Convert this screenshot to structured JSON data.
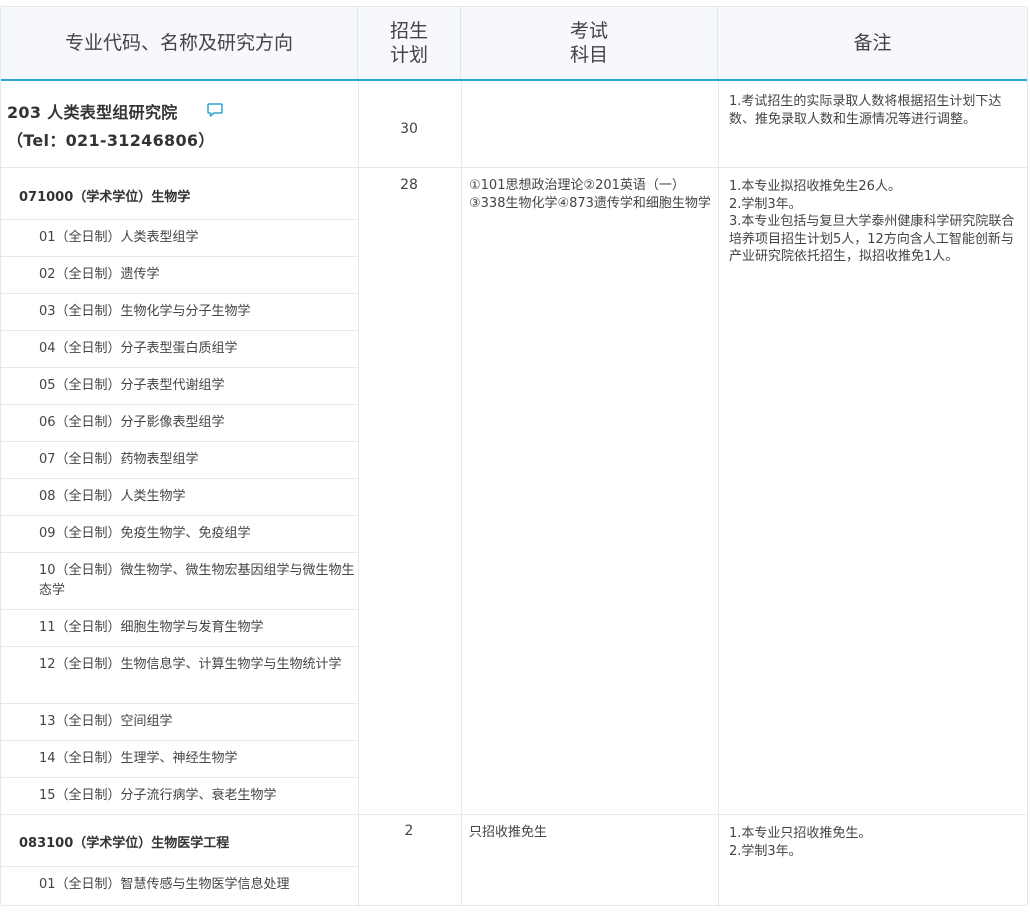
{
  "header": {
    "col1": "专业代码、名称及研究方向",
    "col2_line1": "招生",
    "col2_line2": "计划",
    "col3_line1": "考试",
    "col3_line2": "科目",
    "col4": "备注"
  },
  "institute": {
    "name": "203 人类表型组研究院",
    "tel": "（Tel：021-31246806）",
    "plan": "30",
    "note": "1.考试招生的实际录取人数将根据招生计划下达数、推免录取人数和生源情况等进行调整。",
    "icon": "comment-icon",
    "accent": "#2aa5d6"
  },
  "majors": [
    {
      "title": "071000（学术学位）生物学",
      "plan": "28",
      "exam": "①101思想政治理论②201英语（一）③338生物化学④873遗传学和细胞生物学",
      "notes": [
        "1.本专业拟招收推免生26人。",
        "2.学制3年。",
        "3.本专业包括与复旦大学泰州健康科学研究院联合培养项目招生计划5人，12方向含人工智能创新与产业研究院依托招生，拟招收推免1人。"
      ],
      "directions": [
        "01（全日制）人类表型组学",
        "02（全日制）遗传学",
        "03（全日制）生物化学与分子生物学",
        "04（全日制）分子表型蛋白质组学",
        "05（全日制）分子表型代谢组学",
        "06（全日制）分子影像表型组学",
        "07（全日制）药物表型组学",
        "08（全日制）人类生物学",
        "09（全日制）免疫生物学、免疫组学",
        "10（全日制）微生物学、微生物宏基因组学与微生物生态学",
        "11（全日制）细胞生物学与发育生物学",
        "12（全日制）生物信息学、计算生物学与生物统计学",
        "13（全日制）空间组学",
        "14（全日制）生理学、神经生物学",
        "15（全日制）分子流行病学、衰老生物学"
      ]
    },
    {
      "title": "083100（学术学位）生物医学工程",
      "plan": "2",
      "exam": "只招收推免生",
      "notes": [
        "1.本专业只招收推免生。",
        "2.学制3年。"
      ],
      "directions": [
        "01（全日制）智慧传感与生物医学信息处理"
      ]
    }
  ]
}
